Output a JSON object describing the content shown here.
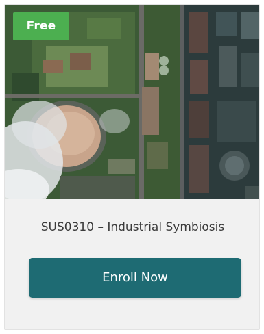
{
  "course_card": {
    "badge_label": "Free",
    "title": "SUS0310 – Industrial Symbiosis",
    "enroll_label": "Enroll Now",
    "image_icon": "aerial-industrial-plant-image"
  },
  "colors": {
    "badge": "#4caf50",
    "button": "#1e6b73",
    "card_background": "#f1f1f1",
    "title_text": "#3b3b3b"
  }
}
